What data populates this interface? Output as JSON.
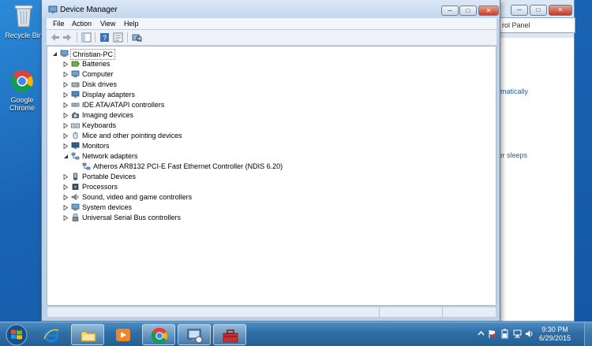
{
  "desktop": {
    "icons": [
      {
        "label": "Recycle Bin"
      },
      {
        "label": "Google Chrome"
      }
    ]
  },
  "background_window": {
    "address_text": "rol Panel",
    "links": [
      "omatically",
      "ter sleeps"
    ]
  },
  "window": {
    "title": "Device Manager",
    "menu": [
      "File",
      "Action",
      "View",
      "Help"
    ],
    "tree": {
      "root": "Christian-PC",
      "items": [
        {
          "label": "Batteries",
          "icon": "battery-icon",
          "expanded": false
        },
        {
          "label": "Computer",
          "icon": "computer-icon",
          "expanded": false
        },
        {
          "label": "Disk drives",
          "icon": "disk-drive-icon",
          "expanded": false
        },
        {
          "label": "Display adapters",
          "icon": "display-adapter-icon",
          "expanded": false
        },
        {
          "label": "IDE ATA/ATAPI controllers",
          "icon": "ide-controller-icon",
          "expanded": false
        },
        {
          "label": "Imaging devices",
          "icon": "camera-icon",
          "expanded": false
        },
        {
          "label": "Keyboards",
          "icon": "keyboard-icon",
          "expanded": false
        },
        {
          "label": "Mice and other pointing devices",
          "icon": "mouse-icon",
          "expanded": false
        },
        {
          "label": "Monitors",
          "icon": "monitor-icon",
          "expanded": false
        },
        {
          "label": "Network adapters",
          "icon": "network-adapter-icon",
          "expanded": true
        },
        {
          "label": "Atheros AR8132 PCI-E Fast Ethernet Controller (NDIS 6.20)",
          "icon": "network-adapter-icon",
          "child": true
        },
        {
          "label": "Portable Devices",
          "icon": "portable-device-icon",
          "expanded": false
        },
        {
          "label": "Processors",
          "icon": "processor-icon",
          "expanded": false
        },
        {
          "label": "Sound, video and game controllers",
          "icon": "sound-icon",
          "expanded": false
        },
        {
          "label": "System devices",
          "icon": "system-device-icon",
          "expanded": false
        },
        {
          "label": "Universal Serial Bus controllers",
          "icon": "usb-icon",
          "expanded": false
        }
      ]
    }
  },
  "taskbar": {
    "time": "9:30 PM",
    "date": "6/29/2015"
  },
  "colors": {
    "desktop": "#1a63b3",
    "window_frame": "#bcd2ea",
    "link": "#1e5cb3"
  }
}
